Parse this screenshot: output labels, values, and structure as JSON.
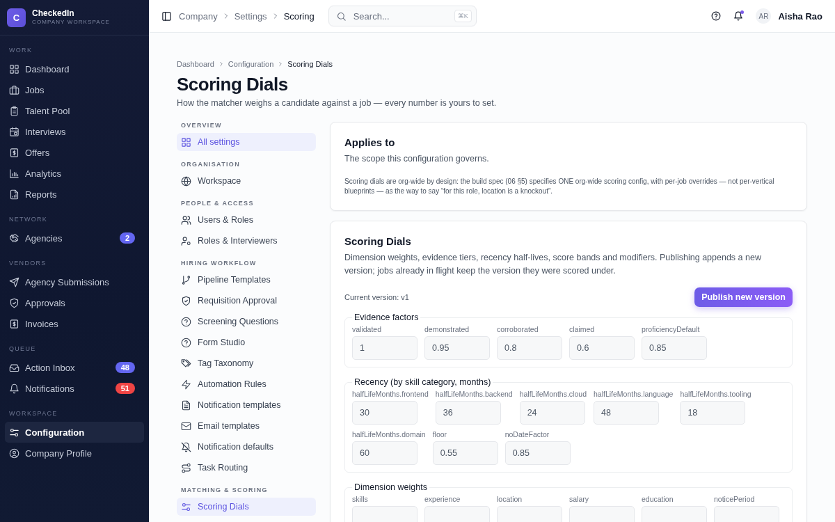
{
  "brand": {
    "logo": "C",
    "name": "CheckedIn",
    "subtitle": "COMPANY WORKSPACE"
  },
  "sidebar": {
    "sections": [
      {
        "title": "WORK",
        "items": [
          {
            "label": "Dashboard",
            "selected": false
          },
          {
            "label": "Jobs",
            "selected": false
          },
          {
            "label": "Talent Pool",
            "selected": false
          },
          {
            "label": "Interviews",
            "selected": false
          },
          {
            "label": "Offers",
            "selected": false
          },
          {
            "label": "Analytics",
            "selected": false
          },
          {
            "label": "Reports",
            "selected": false
          }
        ]
      },
      {
        "title": "NETWORK",
        "items": [
          {
            "label": "Agencies",
            "selected": false,
            "badge": "2",
            "color": "#6366f1"
          }
        ]
      },
      {
        "title": "VENDORS",
        "items": [
          {
            "label": "Agency Submissions",
            "selected": false
          },
          {
            "label": "Approvals",
            "selected": false
          },
          {
            "label": "Invoices",
            "selected": false
          }
        ]
      },
      {
        "title": "QUEUE",
        "items": [
          {
            "label": "Action Inbox",
            "selected": false,
            "badge": "48",
            "color": "#6366f1"
          },
          {
            "label": "Notifications",
            "selected": false,
            "badge": "51",
            "color": "#ef4444"
          }
        ]
      },
      {
        "title": "WORKSPACE",
        "items": [
          {
            "label": "Configuration",
            "selected": true
          },
          {
            "label": "Company Profile",
            "selected": false
          }
        ]
      }
    ]
  },
  "topbar": {
    "breadcrumb": [
      "Company",
      "Settings",
      "Scoring"
    ],
    "search": {
      "placeholder": "Search...",
      "shortcut": "⌘K"
    },
    "user": {
      "initials": "AR",
      "name": "Aisha Rao"
    }
  },
  "page": {
    "breadcrumb": [
      "Dashboard",
      "Configuration",
      "Scoring Dials"
    ],
    "title": "Scoring Dials",
    "subtitle": "How the matcher weighs a candidate against a job — every number is yours to set."
  },
  "settings_nav": [
    {
      "title": "OVERVIEW",
      "items": [
        {
          "label": "All settings",
          "selected": true
        }
      ]
    },
    {
      "title": "ORGANISATION",
      "items": [
        {
          "label": "Workspace",
          "selected": false
        }
      ]
    },
    {
      "title": "PEOPLE & ACCESS",
      "items": [
        {
          "label": "Users & Roles",
          "selected": false
        },
        {
          "label": "Roles & Interviewers",
          "selected": false
        }
      ]
    },
    {
      "title": "HIRING WORKFLOW",
      "items": [
        {
          "label": "Pipeline Templates",
          "selected": false
        },
        {
          "label": "Requisition Approval",
          "selected": false
        },
        {
          "label": "Screening Questions",
          "selected": false
        },
        {
          "label": "Form Studio",
          "selected": false
        },
        {
          "label": "Tag Taxonomy",
          "selected": false
        },
        {
          "label": "Automation Rules",
          "selected": false
        },
        {
          "label": "Notification templates",
          "selected": false
        },
        {
          "label": "Email templates",
          "selected": false
        },
        {
          "label": "Notification defaults",
          "selected": false
        },
        {
          "label": "Task Routing",
          "selected": false
        }
      ]
    },
    {
      "title": "MATCHING & SCORING",
      "items": [
        {
          "label": "Scoring Dials",
          "selected": true
        }
      ]
    }
  ],
  "applies_card": {
    "title": "Applies to",
    "subtitle": "The scope this configuration governs.",
    "note": "Scoring dials are org-wide by design: the build spec (06 §5) specifies ONE org-wide scoring config, with per-job overrides — not per-vertical blueprints — as the way to say “for this role, location is a knockout”."
  },
  "dials_card": {
    "title": "Scoring Dials",
    "subtitle": "Dimension weights, evidence tiers, recency half-lives, score bands and modifiers. Publishing appends a new version; jobs already in flight keep the version they were scored under.",
    "version": "Current version: v1",
    "button": "Publish new version",
    "groups": [
      {
        "legend": "Evidence factors",
        "fields": [
          {
            "label": "validated",
            "value": "1"
          },
          {
            "label": "demonstrated",
            "value": "0.95"
          },
          {
            "label": "corroborated",
            "value": "0.8"
          },
          {
            "label": "claimed",
            "value": "0.6"
          },
          {
            "label": "proficiencyDefault",
            "value": "0.85"
          }
        ]
      },
      {
        "legend": "Recency (by skill category, months)",
        "fields": [
          {
            "label": "halfLifeMonths.frontend",
            "value": "30"
          },
          {
            "label": "halfLifeMonths.backend",
            "value": "36"
          },
          {
            "label": "halfLifeMonths.cloud",
            "value": "24"
          },
          {
            "label": "halfLifeMonths.language",
            "value": "48"
          },
          {
            "label": "halfLifeMonths.tooling",
            "value": "18"
          },
          {
            "label": "halfLifeMonths.domain",
            "value": "60"
          },
          {
            "label": "floor",
            "value": "0.55"
          },
          {
            "label": "noDateFactor",
            "value": "0.85"
          }
        ]
      },
      {
        "legend": "Dimension weights",
        "fields": [
          {
            "label": "skills"
          },
          {
            "label": "experience"
          },
          {
            "label": "location"
          },
          {
            "label": "salary"
          },
          {
            "label": "education"
          },
          {
            "label": "noticePeriod"
          }
        ]
      }
    ]
  }
}
